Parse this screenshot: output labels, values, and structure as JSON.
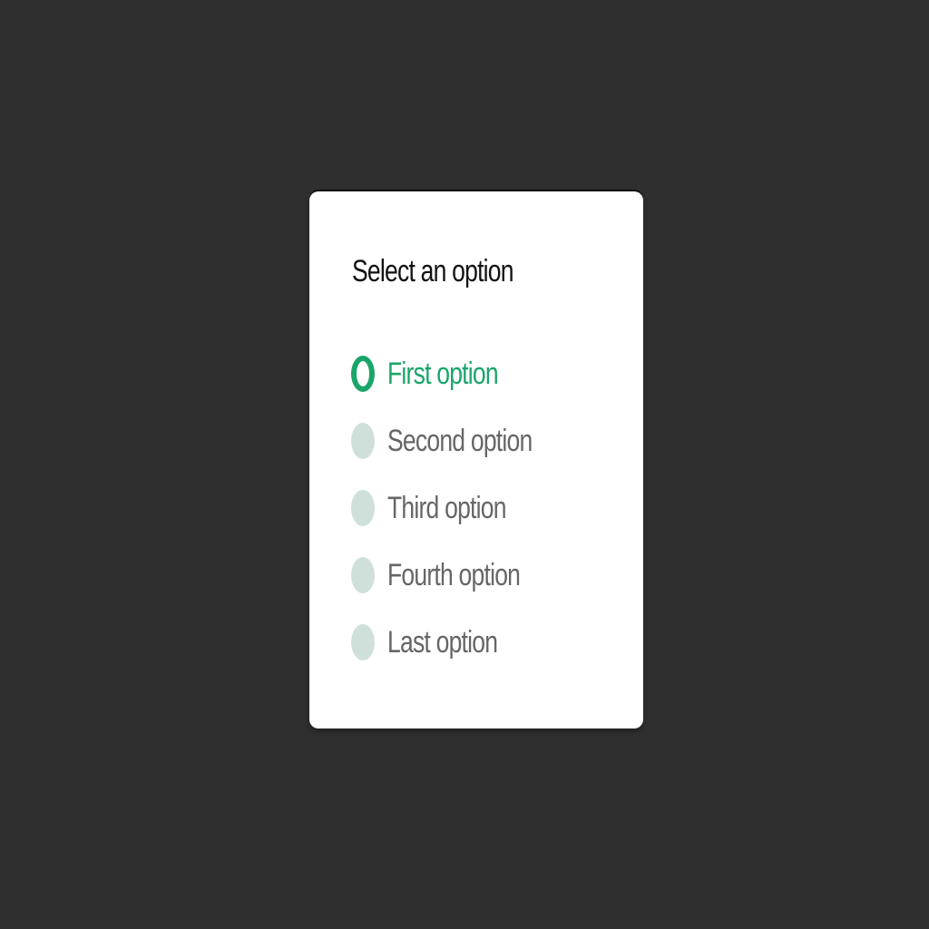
{
  "dialog": {
    "title": "Select an option",
    "selected_index": 0,
    "options": [
      {
        "label": "First option",
        "selected": true
      },
      {
        "label": "Second option",
        "selected": false
      },
      {
        "label": "Third option",
        "selected": false
      },
      {
        "label": "Fourth option",
        "selected": false
      },
      {
        "label": "Last option",
        "selected": false
      }
    ]
  },
  "colors": {
    "background": "#2f2f2f",
    "card": "#ffffff",
    "accent": "#1aa56a",
    "radio_unselected": "#cfe0da",
    "label_unselected": "#666666",
    "title": "#111111"
  }
}
